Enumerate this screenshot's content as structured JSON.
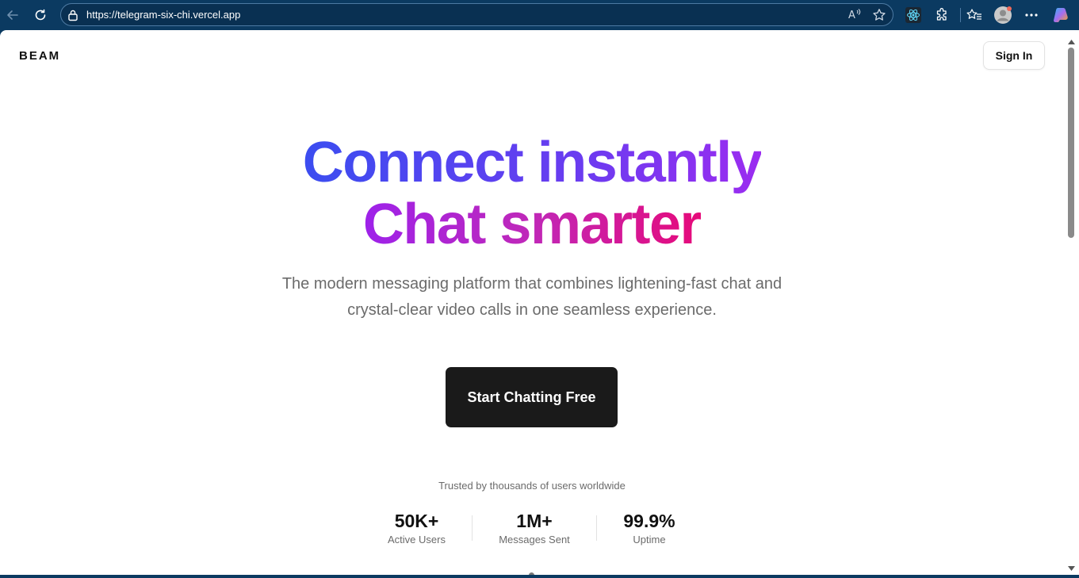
{
  "browser": {
    "url": "https://telegram-six-chi.vercel.app"
  },
  "header": {
    "logo": "BEAM",
    "signin_label": "Sign In"
  },
  "hero": {
    "headline_line1": "Connect instantly",
    "headline_line2": "Chat smarter",
    "subtitle_line1": "The modern messaging platform that combines lightening-fast chat and",
    "subtitle_line2": "crystal-clear video calls in one seamless experience.",
    "cta_label": "Start Chatting Free"
  },
  "stats": {
    "caption": "Trusted by thousands of users worldwide",
    "items": [
      {
        "value": "50K+",
        "label": "Active Users"
      },
      {
        "value": "1M+",
        "label": "Messages Sent"
      },
      {
        "value": "99.9%",
        "label": "Uptime"
      }
    ]
  },
  "colors": {
    "accent_blue": "#3b4df0",
    "accent_purple": "#9b2cf0",
    "accent_pink": "#e60a7a",
    "cta_bg": "#1a1a1a",
    "chrome_bg": "#0b3a61"
  },
  "icons": [
    "back-arrow-icon",
    "refresh-icon",
    "lock-icon",
    "read-aloud-icon",
    "favorite-star-icon",
    "react-devtools-icon",
    "extensions-icon",
    "favorites-icon",
    "profile-avatar-icon",
    "more-icon",
    "copilot-icon"
  ]
}
